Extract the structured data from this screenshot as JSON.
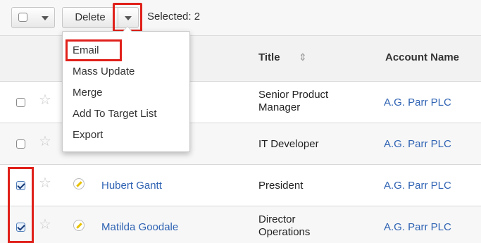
{
  "toolbar": {
    "delete_label": "Delete",
    "selected_text": "Selected: 2"
  },
  "table": {
    "headers": {
      "title": "Title",
      "account_name": "Account Name"
    },
    "rows": [
      {
        "name": "",
        "title": "Senior Product\nManager",
        "account": "A.G. Parr PLC",
        "checked": false
      },
      {
        "name": "",
        "title": "IT Developer",
        "account": "A.G. Parr PLC",
        "checked": false
      },
      {
        "name": "Hubert Gantt",
        "title": "President",
        "account": "A.G. Parr PLC",
        "checked": true
      },
      {
        "name": "Matilda Goodale",
        "title": "Director\nOperations",
        "account": "A.G. Parr PLC",
        "checked": true
      }
    ]
  },
  "menu": {
    "items": [
      {
        "label": "Email"
      },
      {
        "label": "Mass Update"
      },
      {
        "label": "Merge"
      },
      {
        "label": "Add To Target List"
      },
      {
        "label": "Export"
      }
    ]
  },
  "icons": {
    "star": "star-icon",
    "pencil": "pencil-icon",
    "sort": "sort-icon",
    "caret": "chevron-down-icon"
  },
  "colors": {
    "link": "#2f63b3",
    "highlight": "#e0201a"
  }
}
